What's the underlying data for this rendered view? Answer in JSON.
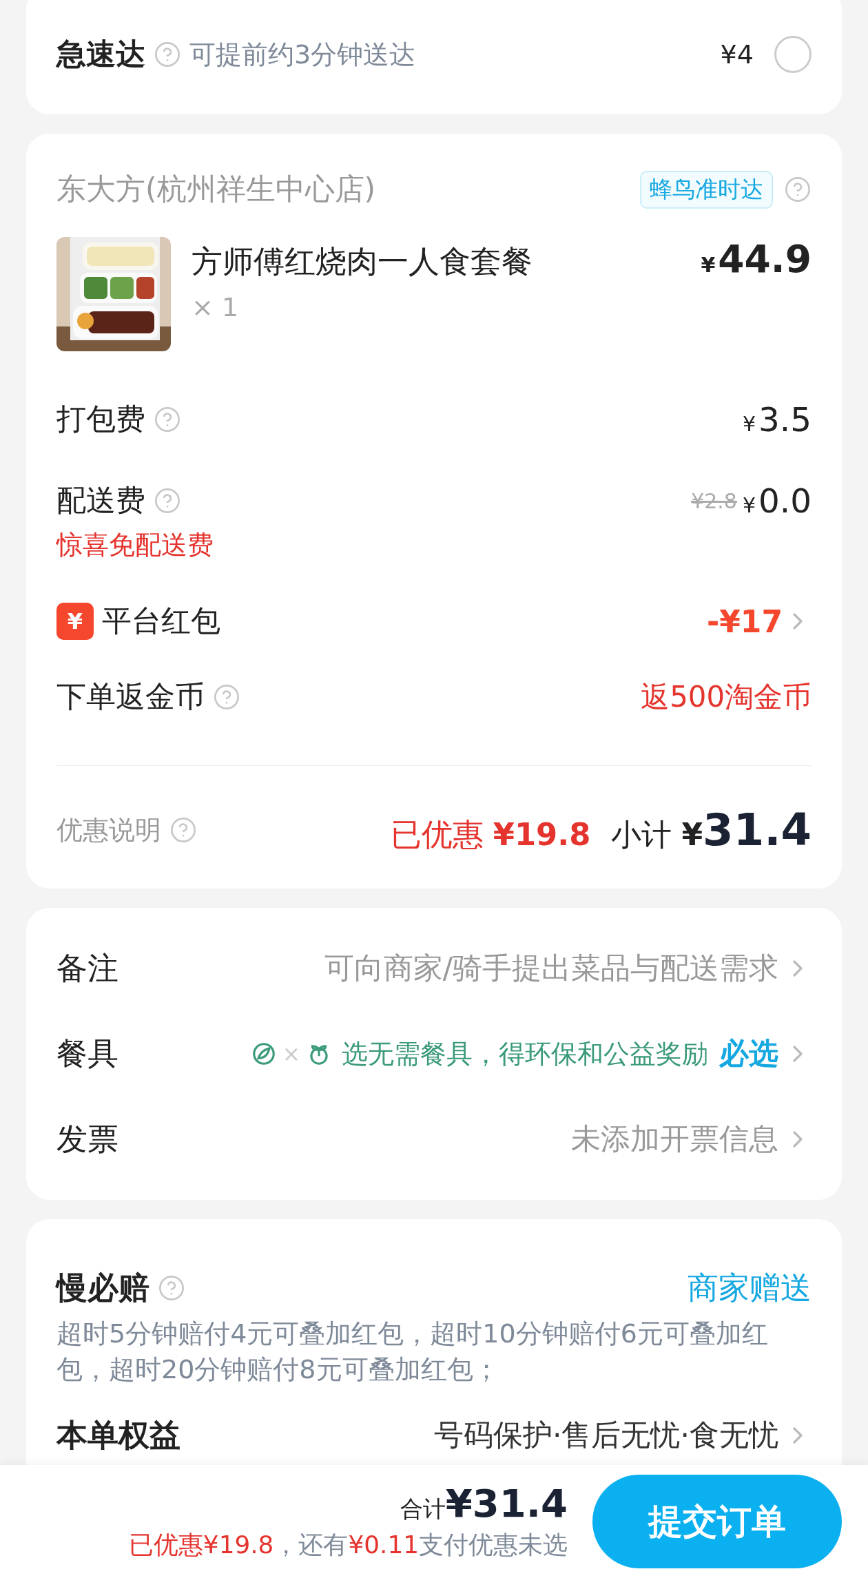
{
  "express": {
    "title": "急速达",
    "hint": "可提前约3分钟送达",
    "price": "¥4",
    "selected": false
  },
  "store": {
    "name": "东大方(杭州祥生中心店)",
    "badge": "蜂鸟准时达",
    "items": [
      {
        "name": "方师傅红烧肉一人食套餐",
        "quantity": "× 1",
        "currency": "¥",
        "price": "44.9"
      }
    ]
  },
  "fees": [
    {
      "kind": "fee",
      "label": "打包费",
      "currency": "¥",
      "amount": "3.5"
    },
    {
      "kind": "fee",
      "label": "配送费",
      "original": "¥2.8",
      "currency": "¥",
      "amount": "0.0",
      "note": "惊喜免配送费"
    },
    {
      "kind": "coupon",
      "label": "平台红包",
      "icon_text": "¥",
      "value": "-¥17"
    },
    {
      "kind": "reward",
      "label": "下单返金币",
      "value": "返500淘金币"
    }
  ],
  "summary": {
    "label": "优惠说明",
    "saved_label": "已优惠",
    "saved_amount": "¥19.8",
    "subtotal_label": "小计",
    "currency": "¥",
    "subtotal": "31.4"
  },
  "options": [
    {
      "kind": "text",
      "label": "备注",
      "value": "可向商家/骑手提出菜品与配送需求"
    },
    {
      "kind": "eco",
      "label": "餐具",
      "joiner": "×",
      "value": "选无需餐具，得环保和公益奖励",
      "tag": "必选"
    },
    {
      "kind": "text",
      "label": "发票",
      "value": "未添加开票信息"
    }
  ],
  "guarantee": {
    "title": "慢必赔",
    "tag": "商家赠送",
    "description": "超时5分钟赔付4元可叠加红包，超时10分钟赔付6元可叠加红包，超时20分钟赔付8元可叠加红包；"
  },
  "benefits": {
    "label": "本单权益",
    "value": "号码保护·售后无忧·食无忧"
  },
  "footer": {
    "total_label": "合计",
    "total": "¥31.4",
    "saved": "已优惠¥19.8",
    "middle": "，还有",
    "extra": "¥0.11",
    "tail": "支付优惠未选",
    "button": "提交订单"
  }
}
